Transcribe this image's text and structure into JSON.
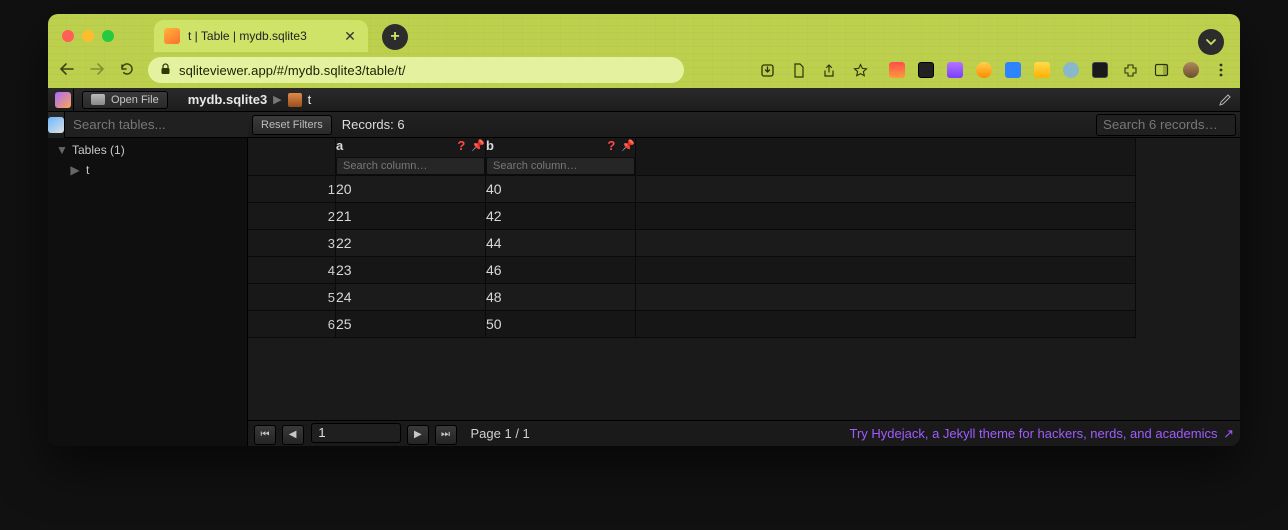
{
  "browser": {
    "tab_title": "t | Table | mydb.sqlite3",
    "url": "sqliteviewer.app/#/mydb.sqlite3/table/t/"
  },
  "breadcrumb": {
    "open_file_label": "Open File",
    "db_name": "mydb.sqlite3",
    "table_name": "t"
  },
  "sidebar": {
    "search_placeholder": "Search tables...",
    "group_label": "Tables (1)",
    "tables": [
      {
        "name": "t"
      }
    ]
  },
  "filters": {
    "reset_label": "Reset Filters",
    "records_label": "Records: 6",
    "search_placeholder": "Search 6 records…"
  },
  "columns": [
    {
      "name": "a",
      "search_placeholder": "Search column…"
    },
    {
      "name": "b",
      "search_placeholder": "Search column…"
    }
  ],
  "rows": [
    {
      "n": "1",
      "a": "20",
      "b": "40"
    },
    {
      "n": "2",
      "a": "21",
      "b": "42"
    },
    {
      "n": "3",
      "a": "22",
      "b": "44"
    },
    {
      "n": "4",
      "a": "23",
      "b": "46"
    },
    {
      "n": "5",
      "a": "24",
      "b": "48"
    },
    {
      "n": "6",
      "a": "25",
      "b": "50"
    }
  ],
  "pager": {
    "current_page": "1",
    "page_label": "Page 1 / 1"
  },
  "promo": {
    "text": "Try Hydejack, a Jekyll theme for hackers, nerds, and academics"
  }
}
